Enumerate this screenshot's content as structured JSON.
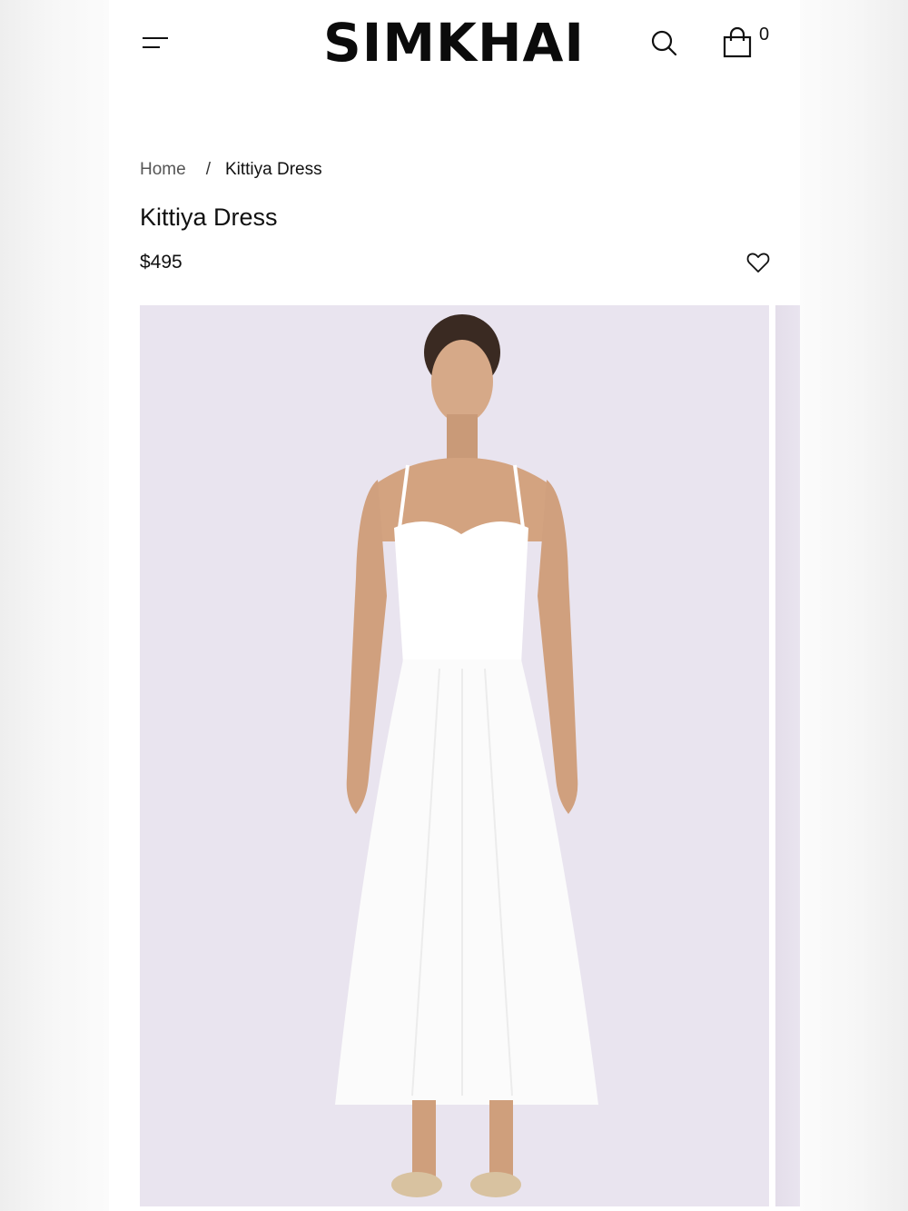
{
  "header": {
    "logo": "SIMKHAI",
    "menu_icon": "hamburger-menu-icon",
    "search_icon": "search-icon",
    "cart_icon": "shopping-bag-icon",
    "cart_count": "0"
  },
  "breadcrumb": {
    "home": "Home",
    "separator": "/",
    "current": "Kittiya Dress"
  },
  "product": {
    "title": "Kittiya Dress",
    "price": "$495",
    "wishlist_icon": "heart-icon"
  },
  "gallery": {
    "background_color": "#e9e4ef"
  }
}
